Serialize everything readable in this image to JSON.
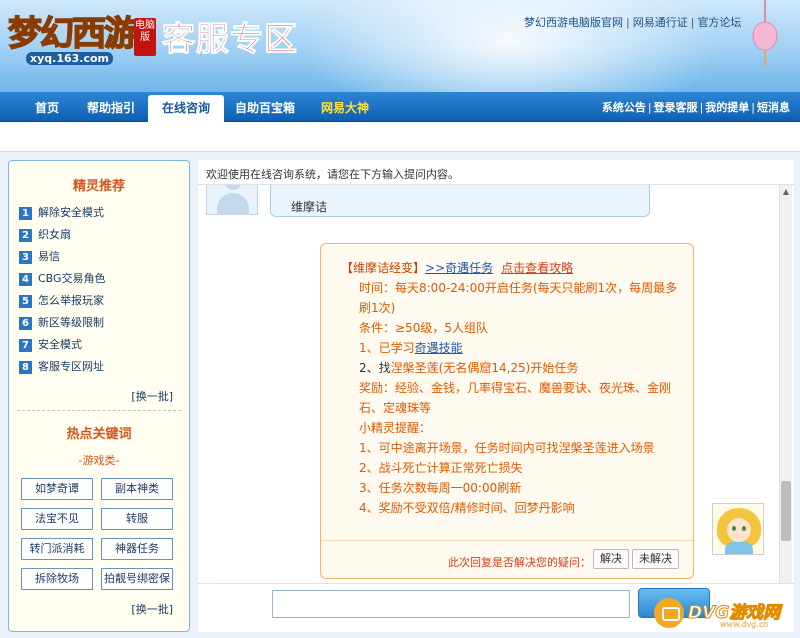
{
  "header": {
    "logo_text": "梦幻西游",
    "logo_badge": "电脑版",
    "logo_url": "xyq.163.com",
    "title": "客服专区",
    "top_links": [
      "梦幻西游电脑版官网",
      "网易通行证",
      "官方论坛"
    ]
  },
  "nav": {
    "tabs": [
      "首页",
      "帮助指引",
      "在线咨询",
      "自助百宝箱",
      "网易大神"
    ],
    "active_tab": "在线咨询",
    "right_links": [
      "系统公告",
      "登录客服",
      "我的提单",
      "短消息"
    ]
  },
  "sidebar": {
    "recommend_title": "精灵推荐",
    "items": [
      {
        "num": "1",
        "label": "解除安全模式"
      },
      {
        "num": "2",
        "label": "织女扇"
      },
      {
        "num": "3",
        "label": "易信"
      },
      {
        "num": "4",
        "label": "CBG交易角色"
      },
      {
        "num": "5",
        "label": "怎么举报玩家"
      },
      {
        "num": "6",
        "label": "新区等级限制"
      },
      {
        "num": "7",
        "label": "安全模式"
      },
      {
        "num": "8",
        "label": "客服专区网址"
      }
    ],
    "more_label": "[换一批]",
    "hot_title": "热点关键词",
    "hot_sub": "-游戏类-",
    "keywords": [
      "如梦奇谭",
      "副本神类",
      "法宝不见",
      "转服",
      "转门派消耗",
      "神器任务",
      "拆除牧场",
      "拍靓号绑密保"
    ],
    "more_label2": "[换一批]"
  },
  "main": {
    "welcome": "欢迎使用在线咨询系统，请您在下方输入提问内容。",
    "user_message": "维摩诘",
    "bot": {
      "head_kw": "【维摩诘经变】",
      "head_link": ">>奇遇任务",
      "head_link2": "点击查看攻略",
      "time_line": "时间：每天8:00-24:00开启任务(每天只能刷1次，每周最多刷1次)",
      "cond_line": "条件：≥50级，5人组队",
      "step1_prefix": "1、已学习",
      "step1_link": "奇遇技能",
      "step2_prefix": "2、找",
      "step2_rest": "涅槃圣莲(无名偶窟14,25)开始任务",
      "reward_line": "奖励：经验、金钱，几率得宝石、魔兽要诀、夜光珠、金刚石、定魂珠等",
      "tips_title": "小精灵提醒：",
      "tips": [
        "1、可中途离开场景，任务时间内可找涅槃圣莲进入场景",
        "2、战斗死亡计算正常死亡损失",
        "3、任务次数每周一00:00刷新",
        "4、奖励不受双倍/精修时间、回梦丹影响"
      ],
      "feedback_question": "此次回复是否解决您的疑问：",
      "resolved_label": "解决",
      "unresolved_label": "未解决"
    }
  },
  "watermark": {
    "text": "DVG游戏网",
    "sub": "www.dvg.cn"
  },
  "colors": {
    "nav_blue": "#105fb0",
    "accent_orange": "#e05a00",
    "header_red": "#c0141a"
  }
}
